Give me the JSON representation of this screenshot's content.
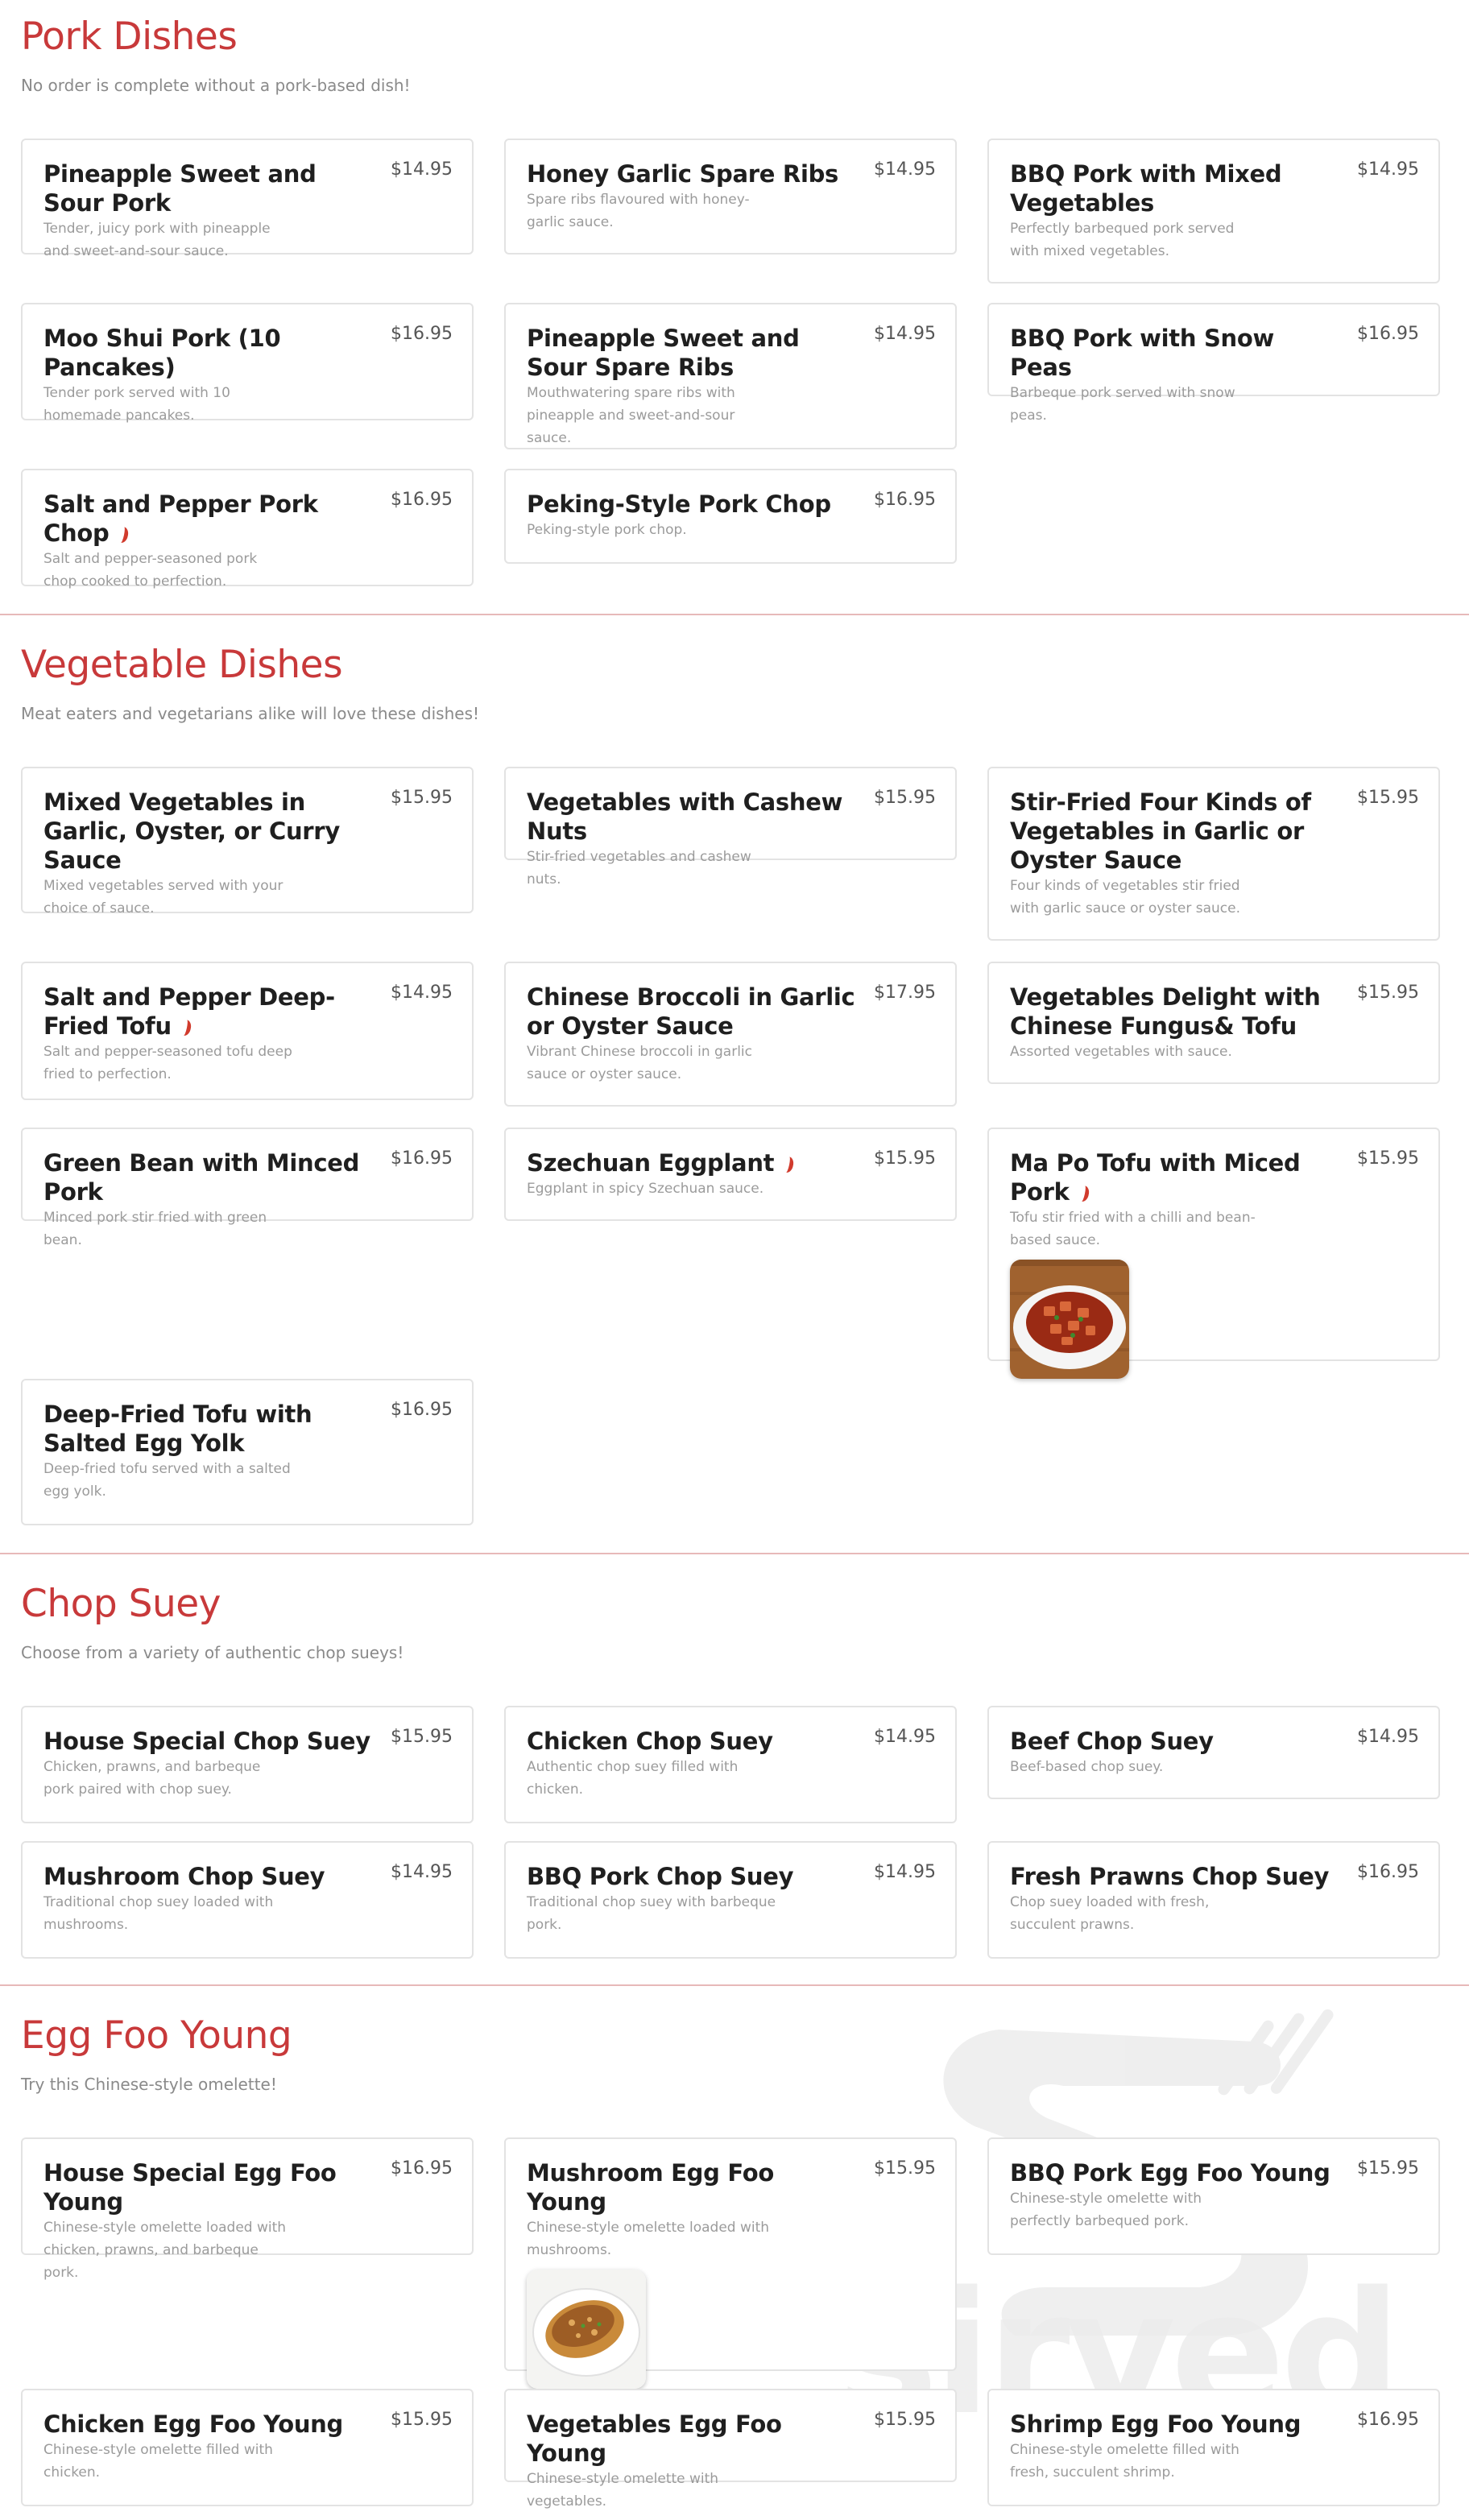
{
  "sections": [
    {
      "title": "Pork Dishes",
      "description": "No order is complete without a pork-based dish!",
      "items": [
        {
          "name": "Pineapple Sweet and Sour Pork",
          "price": "$14.95",
          "description": "Tender, juicy pork with pineapple and sweet-and-sour sauce."
        },
        {
          "name": "Honey Garlic Spare Ribs",
          "price": "$14.95",
          "description": "Spare ribs flavoured with honey-garlic sauce."
        },
        {
          "name": "BBQ Pork with Mixed Vegetables",
          "price": "$14.95",
          "description": "Perfectly barbequed pork served with mixed vegetables."
        },
        {
          "name": "Moo Shui Pork (10 Pancakes)",
          "price": "$16.95",
          "description": "Tender pork served with 10 homemade pancakes."
        },
        {
          "name": "Pineapple Sweet and Sour Spare Ribs",
          "price": "$14.95",
          "description": "Mouthwatering spare ribs with pineapple and sweet-and-sour sauce."
        },
        {
          "name": "BBQ Pork with Snow Peas",
          "price": "$16.95",
          "description": "Barbeque pork served with snow peas."
        },
        {
          "name": "Salt and Pepper Pork Chop",
          "price": "$16.95",
          "description": "Salt and pepper-seasoned pork chop cooked to perfection.",
          "spicy": true
        },
        {
          "name": "Peking-Style Pork Chop",
          "price": "$16.95",
          "description": "Peking-style pork chop."
        }
      ]
    },
    {
      "title": "Vegetable Dishes",
      "description": "Meat eaters and vegetarians alike will love these dishes!",
      "items": [
        {
          "name": "Mixed Vegetables in Garlic, Oyster, or Curry Sauce",
          "price": "$15.95",
          "description": "Mixed vegetables served with your choice of sauce."
        },
        {
          "name": "Vegetables with Cashew Nuts",
          "price": "$15.95",
          "description": "Stir-fried vegetables and cashew nuts."
        },
        {
          "name": "Stir-Fried Four Kinds of Vegetables in Garlic or Oyster Sauce",
          "price": "$15.95",
          "description": "Four kinds of vegetables stir fried with garlic sauce or oyster sauce."
        },
        {
          "name": "Salt and Pepper Deep-Fried Tofu",
          "price": "$14.95",
          "description": "Salt and pepper-seasoned tofu deep fried to perfection.",
          "spicy": true
        },
        {
          "name": "Chinese Broccoli in Garlic or Oyster Sauce",
          "price": "$17.95",
          "description": "Vibrant Chinese broccoli in garlic sauce or oyster sauce."
        },
        {
          "name": "Vegetables Delight with Chinese Fungus& Tofu",
          "price": "$15.95",
          "description": "Assorted vegetables with sauce."
        },
        {
          "name": "Green Bean with Minced Pork",
          "price": "$16.95",
          "description": "Minced pork stir fried with green bean."
        },
        {
          "name": "Szechuan Eggplant",
          "price": "$15.95",
          "description": "Eggplant in spicy Szechuan sauce.",
          "spicy": true
        },
        {
          "name": "Ma Po Tofu with Miced Pork",
          "price": "$15.95",
          "description": "Tofu stir fried with a chilli and bean-based sauce.",
          "spicy": true,
          "image": "mapo-tofu-photo"
        },
        {
          "name": "Deep-Fried Tofu with Salted Egg Yolk",
          "price": "$16.95",
          "description": "Deep-fried tofu served with a salted egg yolk."
        }
      ]
    },
    {
      "title": "Chop Suey",
      "description": "Choose from a variety of authentic chop sueys!",
      "items": [
        {
          "name": "House Special Chop Suey",
          "price": "$15.95",
          "description": "Chicken, prawns, and barbeque pork paired with chop suey."
        },
        {
          "name": "Chicken Chop Suey",
          "price": "$14.95",
          "description": "Authentic chop suey filled with chicken."
        },
        {
          "name": "Beef Chop Suey",
          "price": "$14.95",
          "description": "Beef-based chop suey."
        },
        {
          "name": "Mushroom Chop Suey",
          "price": "$14.95",
          "description": "Traditional chop suey loaded with mushrooms."
        },
        {
          "name": "BBQ Pork Chop Suey",
          "price": "$14.95",
          "description": "Traditional chop suey with barbeque pork."
        },
        {
          "name": "Fresh Prawns Chop Suey",
          "price": "$16.95",
          "description": "Chop suey loaded with fresh, succulent prawns."
        }
      ]
    },
    {
      "title": "Egg Foo Young",
      "description": "Try this Chinese-style omelette!",
      "items": [
        {
          "name": "House Special Egg Foo Young",
          "price": "$16.95",
          "description": "Chinese-style omelette loaded with chicken, prawns, and barbeque pork."
        },
        {
          "name": "Mushroom Egg Foo Young",
          "price": "$15.95",
          "description": "Chinese-style omelette loaded with mushrooms.",
          "image": "egg-foo-young-photo"
        },
        {
          "name": "BBQ Pork Egg Foo Young",
          "price": "$15.95",
          "description": "Chinese-style omelette with perfectly barbequed pork."
        },
        {
          "name": "Chicken Egg Foo Young",
          "price": "$15.95",
          "description": "Chinese-style omelette filled with chicken."
        },
        {
          "name": "Vegetables Egg Foo Young",
          "price": "$15.95",
          "description": "Chinese-style omelette with vegetables."
        },
        {
          "name": "Shrimp Egg Foo Young",
          "price": "$16.95",
          "description": "Chinese-style omelette filled with fresh, succulent shrimp."
        }
      ]
    }
  ],
  "watermark": {
    "text": "sirved",
    "icon": "fork-logo-icon"
  },
  "colors": {
    "accent": "#c8393a",
    "divider": "#e7b9b9",
    "card_border": "#e3e3e3",
    "spicy": "#d13b2d"
  }
}
